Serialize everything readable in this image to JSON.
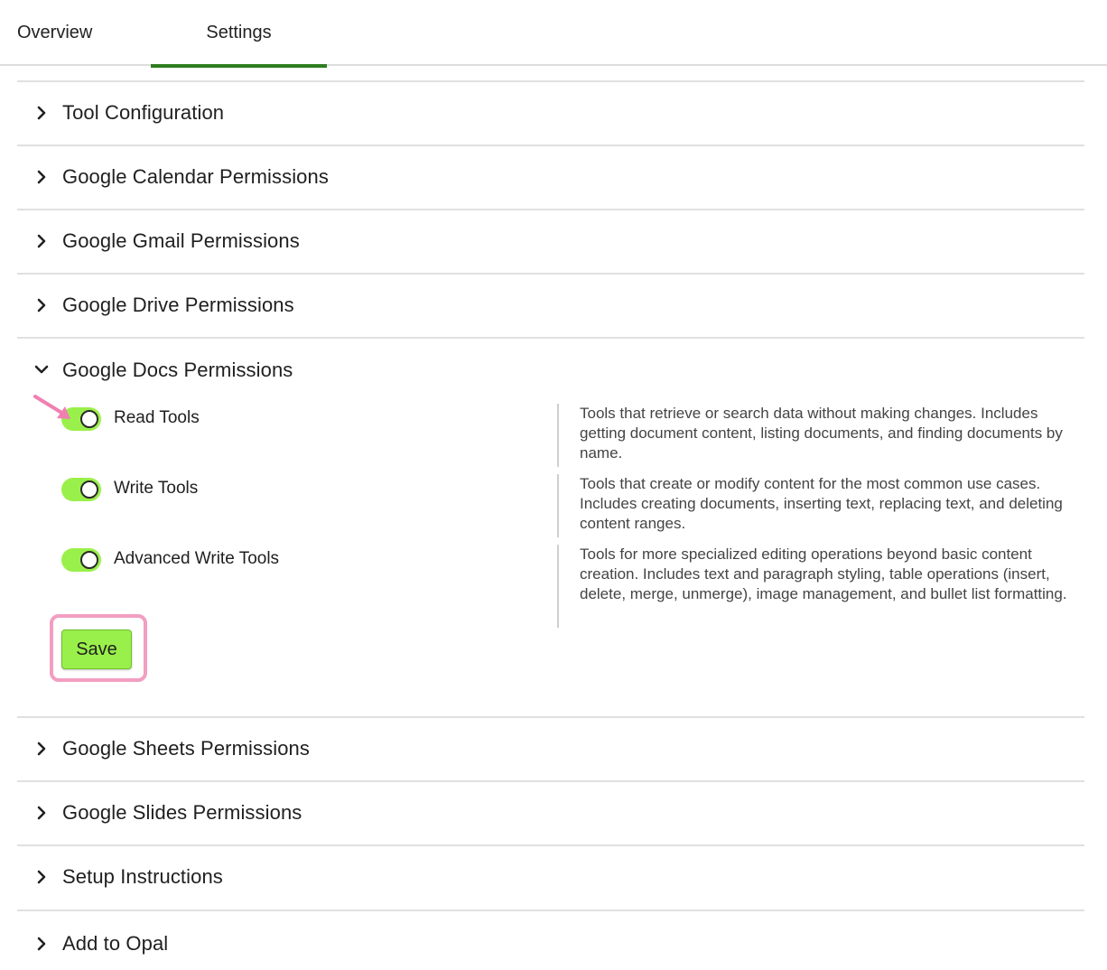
{
  "tabs": {
    "overview": "Overview",
    "settings": "Settings"
  },
  "sections": {
    "tool_configuration": "Tool Configuration",
    "calendar": "Google Calendar Permissions",
    "gmail": "Google Gmail Permissions",
    "drive": "Google Drive Permissions",
    "docs": "Google Docs Permissions",
    "sheets": "Google Sheets Permissions",
    "slides": "Google Slides Permissions",
    "setup": "Setup Instructions",
    "add_to_opal": "Add to Opal"
  },
  "docs_permissions": {
    "read": {
      "label": "Read Tools",
      "enabled": true,
      "description": "Tools that retrieve or search data without making changes. Includes getting document content, listing documents, and finding documents by name."
    },
    "write": {
      "label": "Write Tools",
      "enabled": true,
      "description": "Tools that create or modify content for the most common use cases. Includes creating documents, inserting text, replacing text, and deleting content ranges."
    },
    "advanced": {
      "label": "Advanced Write Tools",
      "enabled": true,
      "description": "Tools for more specialized editing operations beyond basic content creation. Includes text and paragraph styling, table operations (insert, delete, merge, unmerge), image management, and bullet list formatting."
    },
    "save_label": "Save"
  },
  "colors": {
    "accent_green": "#2e7d1f",
    "toggle_on": "#9af04a",
    "highlight_pink": "#f29ec2"
  },
  "icons": {
    "collapsed": "chevron-right-icon",
    "expanded": "chevron-down-icon",
    "annotation": "pink-arrow-icon"
  }
}
